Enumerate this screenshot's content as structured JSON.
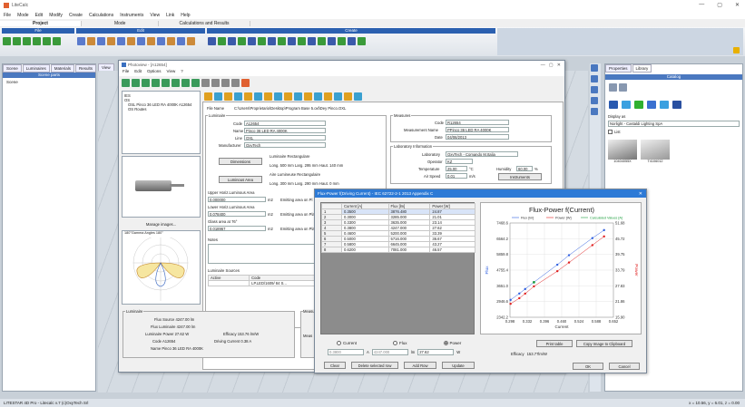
{
  "app": {
    "title": "LiteCalc",
    "window_controls": [
      "—",
      "▢",
      "✕"
    ]
  },
  "menu": [
    "File",
    "Mode",
    "Edit",
    "Modify",
    "Create",
    "Calculations",
    "Instruments",
    "View",
    "Link",
    "Help"
  ],
  "ribbon_tabs": [
    "Project",
    "Mode",
    "Calculations and Results"
  ],
  "ribbon_groups": {
    "file": "File",
    "edit": "Edit",
    "create": "Create"
  },
  "left_tabs": [
    "Scene",
    "Luminaires",
    "Materials",
    "Results",
    "View"
  ],
  "left_panel": {
    "header": "Scene parts",
    "root": "Scene"
  },
  "right_tabs": [
    "Properties",
    "Library"
  ],
  "library": {
    "header": "Catalog",
    "display_label": "Display as",
    "manufacturer": "Norlight - Castaldi Lighting SpA",
    "list_label": "List",
    "item1": "10404055X",
    "item2": "T4106012"
  },
  "statusbar": {
    "left": "LITESTAR 4D Pro - Litecalc v.7   (c)OxyTech Srl",
    "right": "x = 10.56, y = 6.01, z = 0.00"
  },
  "photoview": {
    "title": "Photoview - [A12654]",
    "menu": [
      "File",
      "Edit",
      "Options",
      "View",
      "?"
    ],
    "tree": [
      "IES",
      "OS",
      "OSL Pinco 36 LED RA 4000K A12654",
      "OS Routes"
    ],
    "manage_label": "Manage images...",
    "polar_title": "180°Gamma Angles 180°",
    "filename_label": "File Name",
    "filename": "C:\\Users\\Proprietario\\Desktop\\Program Base 5.oxl\\Dey Pinco.OXL",
    "luminaire": {
      "section": "Luminaire",
      "code_label": "Code",
      "code": "A12654",
      "name_label": "Name",
      "name": "Pinco 36 LED RA 4000K",
      "line_label": "Line",
      "line": "OXL",
      "manufacturer_label": "Manufacturer",
      "manufacturer": "OxyTech"
    },
    "dimensions_btn": "Dimensions",
    "dimensions_text1": "Luminaire Rectangulare",
    "dimensions_text2": "Long. 500 mm  Larg. 295 mm  Haut. 140 mm",
    "luminous_btn": "Luminous Area",
    "luminous_text1": "Aire Lumineuse Rectangulaire",
    "luminous_text2": "Long. 300 mm  Larg. 290 mm  Haut. 0 mm",
    "upper": {
      "label": "Upper Horiz.Luminous Area",
      "value": "0.000000",
      "unit": "m2",
      "side": "Emitting area on Pl"
    },
    "lower": {
      "label": "Lower Horiz.Luminous Area",
      "value": "0.078400",
      "unit": "m2",
      "side": "Emitting area on Pla"
    },
    "glass": {
      "label": "Glass area at 76°",
      "value": "0.018967",
      "unit": "m2",
      "side": "Emitting area on Plan"
    },
    "notes_label": "Notes",
    "sources": {
      "label": "Luminaire Sources",
      "cols": [
        "Active",
        "Code",
        "N"
      ],
      "row": [
        "",
        "LP.LED/1609/ 84 S...",
        "LI"
      ]
    },
    "measure": {
      "section": "Measures",
      "code_label": "Code",
      "code": "R12654",
      "mname_label": "Measurement Name",
      "mname": "PPinco 36 LED RA 4000K",
      "date_label": "Date",
      "date": "04/06/2013"
    },
    "lab": {
      "section": "Laboratory Information",
      "laboratory_label": "Laboratory",
      "laboratory": "OxyTech - Comando M.Italia",
      "operator_label": "Operator",
      "operator": "KZ",
      "temp_label": "Temperature",
      "temp": "25.00",
      "temp_unit": "°C",
      "humidity_label": "Humidity",
      "humidity": "60.00",
      "humidity_unit": "%",
      "airspeed_label": "Air Speed",
      "airspeed": "0.01",
      "airspeed_unit": "m/s",
      "instruments_btn": "Instruments"
    },
    "bottom": {
      "section": "Luminaire",
      "flux_source": "Flux Source  4247.00 lm",
      "flux_lum": "Flux Luminaire  4247.00 lm",
      "power": "Luminaire Power  27.62 W",
      "efficacy": "Efficacy  153.76 lm/W",
      "code": "Code  A12654",
      "driving": "Driving Current  0.38 A",
      "name": "Name  Pinco 36 LED RA 4000K",
      "measure_label": "Measu",
      "meas_label": "Meas"
    }
  },
  "dialog": {
    "title": "Flux-Power f(Driving Current) - IEC 62722-2-1 2013 Appendix C",
    "cols": [
      "",
      "Current [A]",
      "Flux [lm]",
      "Power [W]"
    ],
    "rows": [
      [
        "1",
        "0.3500",
        "3876.480",
        "24.87"
      ],
      [
        "2",
        "0.3000",
        "3285.000",
        "21.01"
      ],
      [
        "3",
        "0.3300",
        "3635.000",
        "23.14"
      ],
      [
        "4",
        "0.3800",
        "4247.000",
        "27.62"
      ],
      [
        "5",
        "0.4600",
        "5200.000",
        "33.39"
      ],
      [
        "6",
        "0.5000",
        "5716.000",
        "36.67"
      ],
      [
        "7",
        "0.5800",
        "6645.000",
        "43.27"
      ],
      [
        "8",
        "0.6200",
        "7081.000",
        "46.57"
      ]
    ],
    "radio_current": "Current",
    "radio_flux": "Flux",
    "radio_power": "Power",
    "in_current": "0.3800",
    "in_flux": "4247.000",
    "in_power": "27.62",
    "unit_a": "A",
    "unit_lm": "lm",
    "unit_w": "W",
    "btn_clear": "Clear",
    "btn_delete": "Delete selected row",
    "btn_add": "Add Row",
    "btn_update": "Update",
    "btn_print": "Print table",
    "btn_copy": "Copy Image to Clipboard",
    "efficacy_label": "Efficacy",
    "efficacy": "153.77lm/W",
    "btn_ok": "OK",
    "btn_cancel": "Cancel"
  },
  "chart_data": {
    "type": "scatter",
    "title": "Flux-Power f(Current)",
    "xlabel": "Current",
    "ylabel_left": "Flux",
    "ylabel_right": "Power",
    "legend": [
      "Flux [lm]",
      "Power [W]",
      "Calculated Values [A]"
    ],
    "x_ticks": [
      "0.298",
      "0.332",
      "0.396",
      "0.460",
      "0.524",
      "0.588",
      "0.652"
    ],
    "y_left_ticks": [
      "2342.2",
      "2946.6",
      "3651.0",
      "4755.4",
      "5859.8",
      "6564.2",
      "7468.6"
    ],
    "y_right_ticks": [
      "15.90",
      "21.86",
      "27.83",
      "33.79",
      "39.75",
      "45.72",
      "51.68"
    ],
    "xlim": [
      0.298,
      0.652
    ],
    "ylim_left": [
      2342.2,
      7468.6
    ],
    "ylim_right": [
      15.9,
      51.68
    ],
    "flux": [
      [
        0.3,
        3285
      ],
      [
        0.33,
        3635
      ],
      [
        0.35,
        3876.48
      ],
      [
        0.38,
        4247
      ],
      [
        0.46,
        5200
      ],
      [
        0.5,
        5716
      ],
      [
        0.58,
        6645
      ],
      [
        0.62,
        7081
      ]
    ],
    "power": [
      [
        0.3,
        21.01
      ],
      [
        0.33,
        23.14
      ],
      [
        0.35,
        24.87
      ],
      [
        0.38,
        27.62
      ],
      [
        0.46,
        33.39
      ],
      [
        0.5,
        36.67
      ],
      [
        0.58,
        43.27
      ],
      [
        0.62,
        46.57
      ]
    ],
    "calculated": [
      [
        0.38,
        4247
      ]
    ],
    "colors": {
      "flux": "#3060e0",
      "power": "#e02020",
      "calc": "#20a040"
    }
  }
}
